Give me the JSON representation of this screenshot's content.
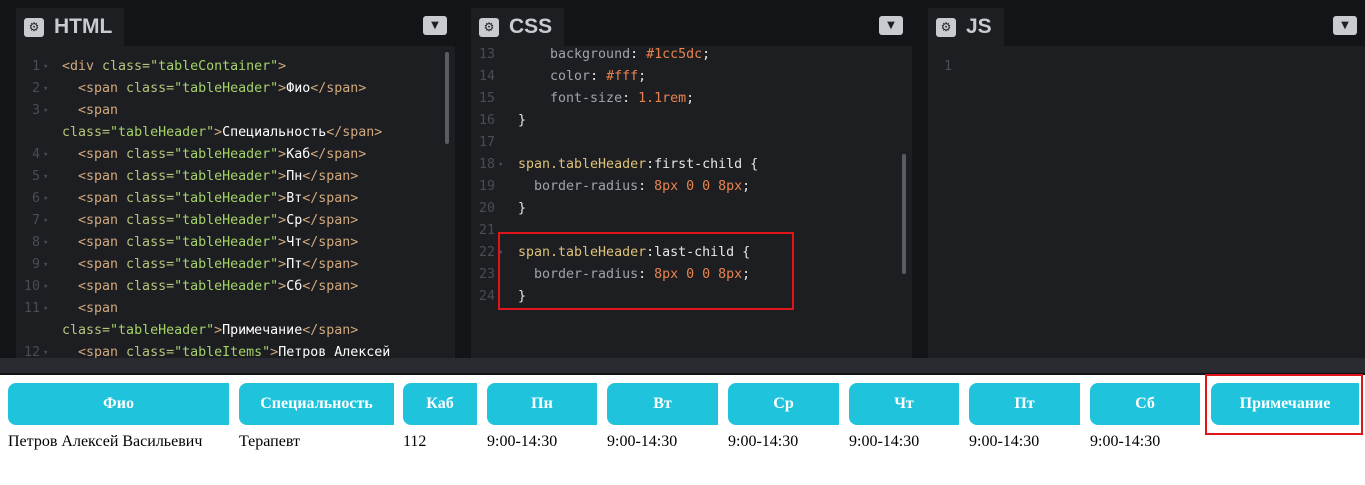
{
  "panes": {
    "html": {
      "title": "HTML",
      "lines": [
        {
          "n": "1",
          "parts": [
            [
              "t-tag",
              "<div "
            ],
            [
              "t-attr",
              "class="
            ],
            [
              "t-str",
              "\"tableContainer\""
            ],
            [
              "t-tag",
              ">"
            ]
          ]
        },
        {
          "n": "2",
          "parts": [
            [
              "t-tag",
              "  <span "
            ],
            [
              "t-attr",
              "class="
            ],
            [
              "t-str",
              "\"tableHeader\""
            ],
            [
              "t-tag",
              ">"
            ],
            [
              "t-plain",
              "Фио"
            ],
            [
              "t-tag",
              "</span>"
            ]
          ]
        },
        {
          "n": "3",
          "parts": [
            [
              "t-tag",
              "  <span"
            ]
          ]
        },
        {
          "n": "",
          "wrap": true,
          "parts": [
            [
              "t-attr",
              "class="
            ],
            [
              "t-str",
              "\"tableHeader\""
            ],
            [
              "t-tag",
              ">"
            ],
            [
              "t-plain",
              "Специальность"
            ],
            [
              "t-tag",
              "</span>"
            ]
          ]
        },
        {
          "n": "4",
          "parts": [
            [
              "t-tag",
              "  <span "
            ],
            [
              "t-attr",
              "class="
            ],
            [
              "t-str",
              "\"tableHeader\""
            ],
            [
              "t-tag",
              ">"
            ],
            [
              "t-plain",
              "Каб"
            ],
            [
              "t-tag",
              "</span>"
            ]
          ]
        },
        {
          "n": "5",
          "parts": [
            [
              "t-tag",
              "  <span "
            ],
            [
              "t-attr",
              "class="
            ],
            [
              "t-str",
              "\"tableHeader\""
            ],
            [
              "t-tag",
              ">"
            ],
            [
              "t-plain",
              "Пн"
            ],
            [
              "t-tag",
              "</span>"
            ]
          ]
        },
        {
          "n": "6",
          "parts": [
            [
              "t-tag",
              "  <span "
            ],
            [
              "t-attr",
              "class="
            ],
            [
              "t-str",
              "\"tableHeader\""
            ],
            [
              "t-tag",
              ">"
            ],
            [
              "t-plain",
              "Вт"
            ],
            [
              "t-tag",
              "</span>"
            ]
          ]
        },
        {
          "n": "7",
          "parts": [
            [
              "t-tag",
              "  <span "
            ],
            [
              "t-attr",
              "class="
            ],
            [
              "t-str",
              "\"tableHeader\""
            ],
            [
              "t-tag",
              ">"
            ],
            [
              "t-plain",
              "Ср"
            ],
            [
              "t-tag",
              "</span>"
            ]
          ]
        },
        {
          "n": "8",
          "parts": [
            [
              "t-tag",
              "  <span "
            ],
            [
              "t-attr",
              "class="
            ],
            [
              "t-str",
              "\"tableHeader\""
            ],
            [
              "t-tag",
              ">"
            ],
            [
              "t-plain",
              "Чт"
            ],
            [
              "t-tag",
              "</span>"
            ]
          ]
        },
        {
          "n": "9",
          "parts": [
            [
              "t-tag",
              "  <span "
            ],
            [
              "t-attr",
              "class="
            ],
            [
              "t-str",
              "\"tableHeader\""
            ],
            [
              "t-tag",
              ">"
            ],
            [
              "t-plain",
              "Пт"
            ],
            [
              "t-tag",
              "</span>"
            ]
          ]
        },
        {
          "n": "10",
          "parts": [
            [
              "t-tag",
              "  <span "
            ],
            [
              "t-attr",
              "class="
            ],
            [
              "t-str",
              "\"tableHeader\""
            ],
            [
              "t-tag",
              ">"
            ],
            [
              "t-plain",
              "Сб"
            ],
            [
              "t-tag",
              "</span>"
            ]
          ]
        },
        {
          "n": "11",
          "parts": [
            [
              "t-tag",
              "  <span"
            ]
          ]
        },
        {
          "n": "",
          "wrap": true,
          "parts": [
            [
              "t-attr",
              "class="
            ],
            [
              "t-str",
              "\"tableHeader\""
            ],
            [
              "t-tag",
              ">"
            ],
            [
              "t-plain",
              "Примечание"
            ],
            [
              "t-tag",
              "</span>"
            ]
          ]
        },
        {
          "n": "12",
          "parts": [
            [
              "t-tag",
              "  <span "
            ],
            [
              "t-attr",
              "class="
            ],
            [
              "t-str",
              "\"tableItems\""
            ],
            [
              "t-tag",
              ">"
            ],
            [
              "t-plain",
              "Петров Алексей"
            ]
          ]
        }
      ]
    },
    "css": {
      "title": "CSS",
      "lines": [
        {
          "n": "13",
          "parts": [
            [
              "t-prop",
              "    background"
            ],
            [
              "t-val",
              ": "
            ],
            [
              "t-num",
              "#1cc5dc"
            ],
            [
              "t-val",
              ";"
            ]
          ]
        },
        {
          "n": "14",
          "parts": [
            [
              "t-prop",
              "    color"
            ],
            [
              "t-val",
              ": "
            ],
            [
              "t-num",
              "#fff"
            ],
            [
              "t-val",
              ";"
            ]
          ]
        },
        {
          "n": "15",
          "parts": [
            [
              "t-prop",
              "    font-size"
            ],
            [
              "t-val",
              ": "
            ],
            [
              "t-num",
              "1.1rem"
            ],
            [
              "t-val",
              ";"
            ]
          ]
        },
        {
          "n": "16",
          "parts": [
            [
              "t-val",
              "}"
            ]
          ]
        },
        {
          "n": "17",
          "parts": []
        },
        {
          "n": "18",
          "parts": [
            [
              "t-sel",
              "span.tableHeader"
            ],
            [
              "t-pseudo",
              ":first-child {"
            ]
          ]
        },
        {
          "n": "19",
          "parts": [
            [
              "t-prop",
              "  border-radius"
            ],
            [
              "t-val",
              ": "
            ],
            [
              "t-num",
              "8px 0 0 8px"
            ],
            [
              "t-val",
              ";"
            ]
          ]
        },
        {
          "n": "20",
          "parts": [
            [
              "t-val",
              "}"
            ]
          ]
        },
        {
          "n": "21",
          "parts": []
        },
        {
          "n": "22",
          "parts": [
            [
              "t-sel",
              "span.tableHeader"
            ],
            [
              "t-pseudo",
              ":last-child {"
            ]
          ]
        },
        {
          "n": "23",
          "parts": [
            [
              "t-prop",
              "  border-radius"
            ],
            [
              "t-val",
              ": "
            ],
            [
              "t-num",
              "8px 0 0 8px"
            ],
            [
              "t-val",
              ";"
            ]
          ]
        },
        {
          "n": "24",
          "parts": [
            [
              "t-val",
              "}"
            ]
          ]
        }
      ]
    },
    "js": {
      "title": "JS",
      "lines": [
        {
          "n": "1",
          "parts": []
        }
      ]
    }
  },
  "preview": {
    "headers": [
      "Фио",
      "Специальность",
      "Каб",
      "Пн",
      "Вт",
      "Ср",
      "Чт",
      "Пт",
      "Сб",
      "Примечание"
    ],
    "row": [
      "Петров Алексей Васильевич",
      "Терапевт",
      "112",
      "9:00-14:30",
      "9:00-14:30",
      "9:00-14:30",
      "9:00-14:30",
      "9:00-14:30",
      "9:00-14:30"
    ]
  },
  "colors": {
    "header_bg": "#1fc4dc",
    "editor_bg": "#1d1e22",
    "highlight": "#e0141b"
  }
}
